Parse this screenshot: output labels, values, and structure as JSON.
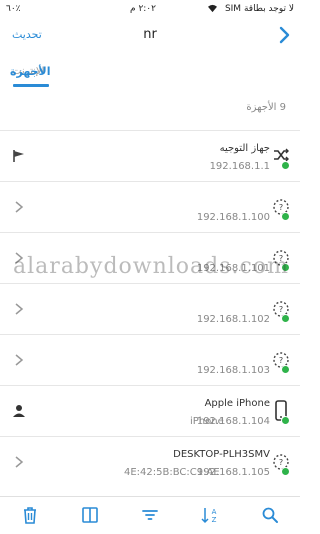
{
  "status": {
    "carrier": "لا توجد بطاقة SIM",
    "time": "٢:٠٢ م",
    "battery": "٦٠٪"
  },
  "nav": {
    "refresh": "تحديث",
    "title": "nr"
  },
  "tabs": {
    "devices": "الأجهزة",
    "internet": "الإنترنت"
  },
  "count": "9 الأجهزة",
  "devices": [
    {
      "name": "جهاز التوجيه",
      "ip": "192.168.1.1",
      "left": "flag",
      "icon": "router"
    },
    {
      "name": "",
      "ip": "192.168.1.100",
      "left": "chevron",
      "icon": "unknown"
    },
    {
      "name": "",
      "ip": "192.168.1.101",
      "left": "chevron",
      "icon": "unknown"
    },
    {
      "name": "",
      "ip": "192.168.1.102",
      "left": "chevron",
      "icon": "unknown"
    },
    {
      "name": "",
      "ip": "192.168.1.103",
      "left": "chevron",
      "icon": "unknown"
    },
    {
      "name": "Apple iPhone",
      "ip": "192.168.1.104",
      "extra": "iPhone",
      "left": "person",
      "icon": "phone"
    },
    {
      "name": "DESKTOP-PLH3SMV",
      "ip": "192.168.1.105",
      "mac": "4E:42:5B:BC:C9:AE",
      "left": "chevron",
      "icon": "unknown"
    }
  ],
  "watermark": "alarabydownloads.com",
  "colors": {
    "accent": "#2a8bd6",
    "online": "#2fb34a"
  }
}
